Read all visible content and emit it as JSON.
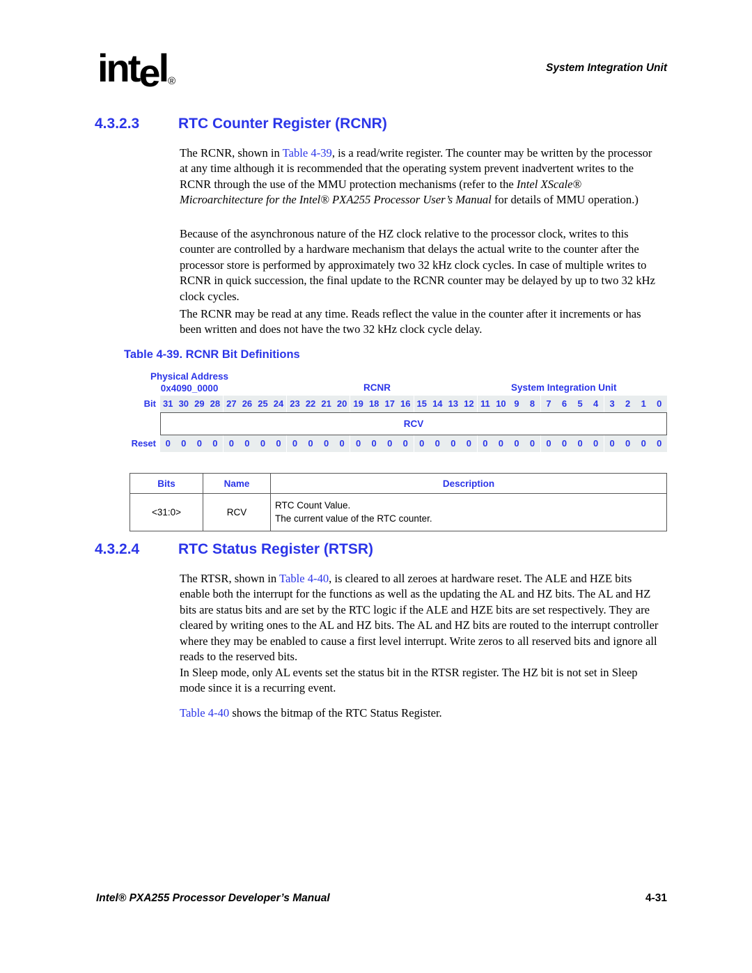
{
  "header": {
    "logo_text_1": "int",
    "logo_text_e": "e",
    "logo_text_2": "l",
    "logo_reg": "®",
    "running_head": "System Integration Unit"
  },
  "sections": [
    {
      "number": "4.3.2.3",
      "title": "RTC Counter Register (RCNR)"
    },
    {
      "number": "4.3.2.4",
      "title": "RTC Status Register (RTSR)"
    }
  ],
  "paragraphs": {
    "p1_a": "The RCNR, shown in ",
    "p1_xref": "Table 4-39",
    "p1_b": ", is a read/write register. The counter may be written by the processor at any time although it is recommended that the operating system prevent inadvertent writes to the RCNR through the use of the MMU protection mechanisms (refer to the ",
    "p1_italic": "Intel XScale® Microarchitecture for the Intel® PXA255 Processor User’s Manual",
    "p1_c": " for details of MMU operation.)",
    "p2": "Because of the asynchronous nature of the HZ clock relative to the processor clock, writes to this counter are controlled by a hardware mechanism that delays the actual write to the counter after the processor store is performed by approximately two 32 kHz clock cycles. In case of multiple writes to RCNR in quick succession, the final update to the RCNR counter may be delayed by up to two 32 kHz clock cycles.",
    "p3": "The RCNR may be read at any time. Reads reflect the value in the counter after it increments or has been written and does not have the two 32 kHz clock cycle delay.",
    "p4_a": "The RTSR, shown in ",
    "p4_xref": "Table 4-40",
    "p4_b": ", is cleared to all zeroes at hardware reset. The ALE and HZE bits enable both the interrupt for the functions as well as the updating the AL and HZ bits. The AL and HZ bits are status bits and are set by the RTC logic if the ALE and HZE bits are set respectively. They are cleared by writing ones to the AL and HZ bits. The AL and HZ bits are routed to the interrupt controller where they may be enabled to cause a first level interrupt. Write zeros to all reserved bits and ignore all reads to the reserved bits.",
    "p5": "In Sleep mode, only AL events set the status bit in the RTSR register. The HZ bit is not set in Sleep mode since it is a recurring event.",
    "p6_xref": "Table 4-40",
    "p6_b": " shows the bitmap of the RTC Status Register."
  },
  "table_39": {
    "caption": "Table 4-39. RCNR Bit Definitions",
    "physical_address_label": "Physical Address",
    "physical_address_value": "0x4090_0000",
    "register_name": "RCNR",
    "unit_name": "System Integration Unit",
    "bit_row_label": "Bit",
    "reset_row_label": "Reset",
    "bits": [
      "31",
      "30",
      "29",
      "28",
      "27",
      "26",
      "25",
      "24",
      "23",
      "22",
      "21",
      "20",
      "19",
      "18",
      "17",
      "16",
      "15",
      "14",
      "13",
      "12",
      "11",
      "10",
      "9",
      "8",
      "7",
      "6",
      "5",
      "4",
      "3",
      "2",
      "1",
      "0"
    ],
    "reset_values": [
      "0",
      "0",
      "0",
      "0",
      "0",
      "0",
      "0",
      "0",
      "0",
      "0",
      "0",
      "0",
      "0",
      "0",
      "0",
      "0",
      "0",
      "0",
      "0",
      "0",
      "0",
      "0",
      "0",
      "0",
      "0",
      "0",
      "0",
      "0",
      "0",
      "0",
      "0",
      "0"
    ],
    "field_name": "RCV",
    "columns": [
      "Bits",
      "Name",
      "Description"
    ],
    "rows": [
      {
        "bits": "<31:0>",
        "name": "RCV",
        "description_line1": "RTC Count Value.",
        "description_line2": "The current value of the RTC counter."
      }
    ]
  },
  "footer": {
    "manual_title": "Intel® PXA255 Processor Developer’s Manual",
    "page_number": "4-31"
  },
  "colors": {
    "accent_blue": "#2b35e8",
    "rule_gray": "#555555",
    "bitrow_bg": "#e9edee"
  }
}
